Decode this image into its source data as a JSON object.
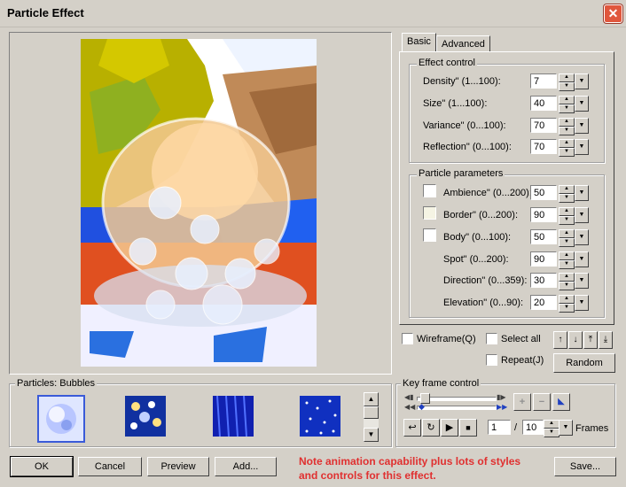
{
  "window": {
    "title": "Particle Effect",
    "close_symbol": "✕"
  },
  "tabs": [
    {
      "label": "Basic"
    },
    {
      "label": "Advanced"
    }
  ],
  "effect_control": {
    "label": "Effect control",
    "fields": [
      {
        "label": "Density\" (1...100):",
        "value": "7"
      },
      {
        "label": "Size\" (1...100):",
        "value": "40"
      },
      {
        "label": "Variance\" (0...100):",
        "value": "70"
      },
      {
        "label": "Reflection\" (0...100):",
        "value": "70"
      }
    ]
  },
  "particle_parameters": {
    "label": "Particle parameters",
    "fields": [
      {
        "label": "Ambience\" (0...200):",
        "value": "50",
        "swatch": "#ffffff"
      },
      {
        "label": "Border\" (0...200):",
        "value": "90",
        "swatch": "#f5f4e4"
      },
      {
        "label": "Body\" (0...100):",
        "value": "50",
        "swatch": "#ffffff"
      },
      {
        "label": "Spot\" (0...200):",
        "value": "90"
      },
      {
        "label": "Direction\" (0...359):",
        "value": "30"
      },
      {
        "label": "Elevation\" (0...90):",
        "value": "20"
      }
    ]
  },
  "options": {
    "wireframe": "Wireframe(Q)",
    "select_all": "Select all",
    "repeat": "Repeat(J)",
    "random": "Random"
  },
  "particles": {
    "label": "Particles: Bubbles"
  },
  "keyframe": {
    "label": "Key frame control",
    "frame": "1",
    "separator": "/",
    "total": "10",
    "frames_label": "Frames"
  },
  "buttons": {
    "ok": "OK",
    "cancel": "Cancel",
    "preview": "Preview",
    "add": "Add...",
    "save": "Save..."
  },
  "note": {
    "line1": "Note animation capability plus lots of styles",
    "line2": "and controls for this effect."
  }
}
